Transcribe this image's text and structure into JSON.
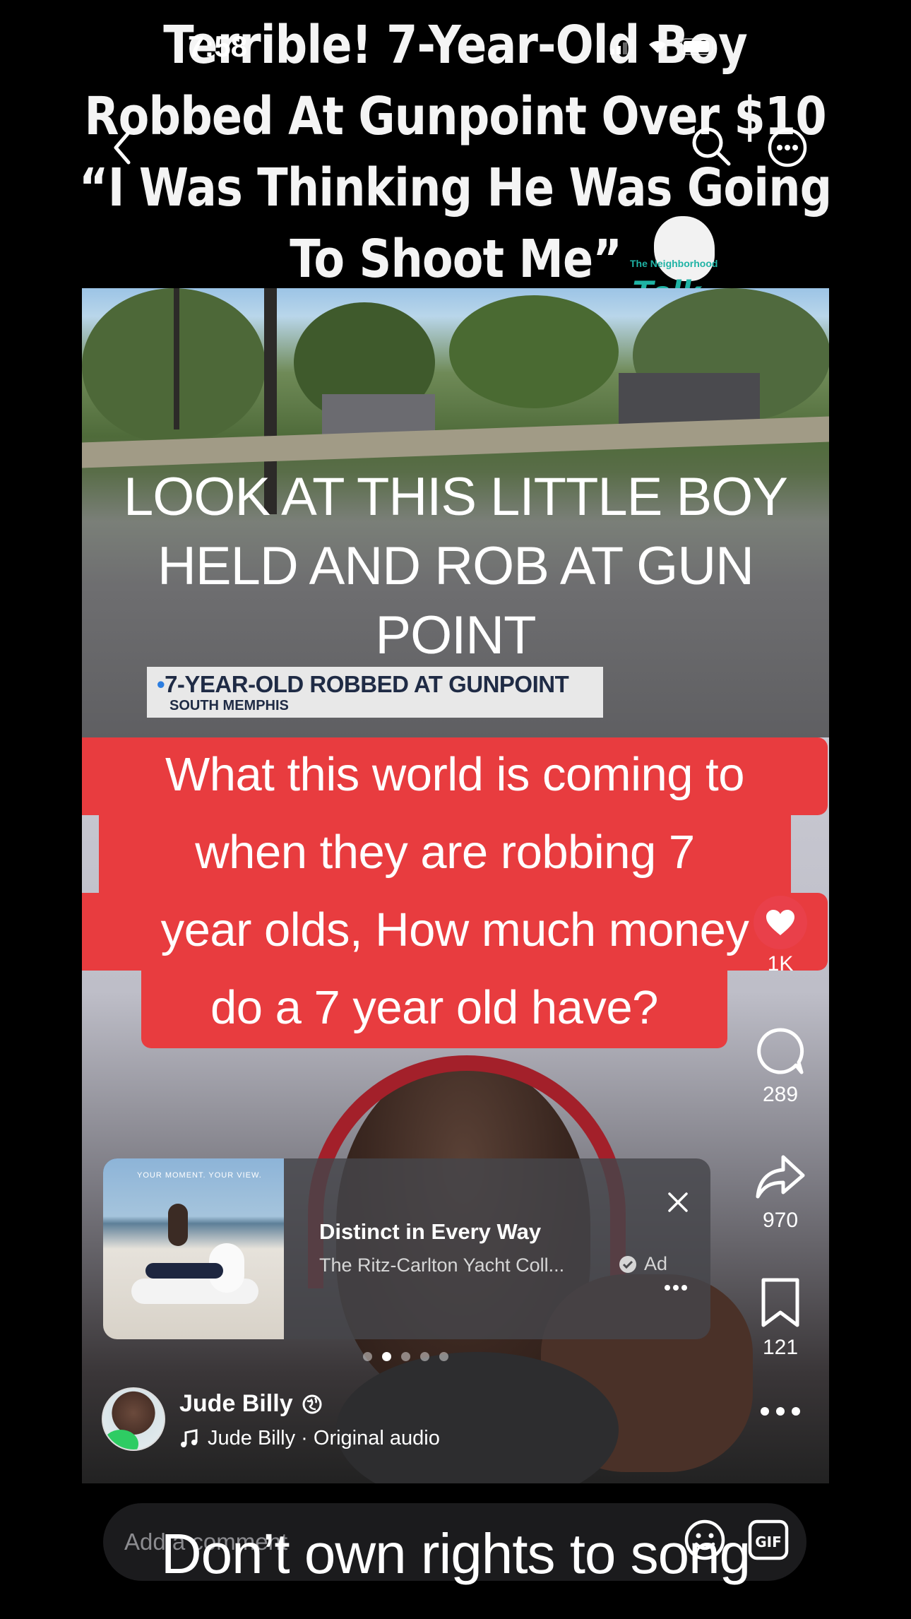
{
  "status_bar": {
    "time": "7:58"
  },
  "video": {
    "headline_lines": [
      "Terrible! 7-Year-Old Boy",
      "Robbed At Gunpoint Over $10",
      "“I Was Thinking He Was Going",
      "To Shoot Me”"
    ],
    "logo": {
      "small": "The Neighborhood",
      "big": "Talk"
    },
    "white_caption": [
      "LOOK AT THIS LITTLE BOY",
      "HELD AND ROB AT GUN",
      "POINT"
    ],
    "news_bar": {
      "title": "7-YEAR-OLD ROBBED AT GUNPOINT",
      "subtitle": "SOUTH MEMPHIS"
    },
    "red_caption": [
      "What this world is coming to",
      "when they are robbing 7",
      "year olds, How much money",
      "do a 7 year old have?"
    ]
  },
  "actions": {
    "likes": "1K",
    "comments": "289",
    "shares": "970",
    "saves": "121"
  },
  "ad": {
    "thumb_text": "YOUR MOMENT. YOUR VIEW.",
    "title": "Distinct in Every Way",
    "sponsor": "The Ritz-Carlton Yacht Coll...",
    "tag": "Ad"
  },
  "author": {
    "name": "Jude Billy",
    "audio": "Jude Billy · Original audio"
  },
  "comment": {
    "placeholder": "Add a comment"
  },
  "overlay": {
    "text": "Don’t own rights to song"
  },
  "colors": {
    "like": "#e9404a",
    "caption_red": "#e83c3f",
    "headphone": "#a3202a"
  },
  "icons": [
    "back-icon",
    "search-icon",
    "more-icon",
    "heart-icon",
    "comment-icon",
    "share-icon",
    "bookmark-icon",
    "globe-icon",
    "music-icon",
    "verified-icon",
    "close-icon",
    "emoji-icon",
    "gif-icon"
  ]
}
